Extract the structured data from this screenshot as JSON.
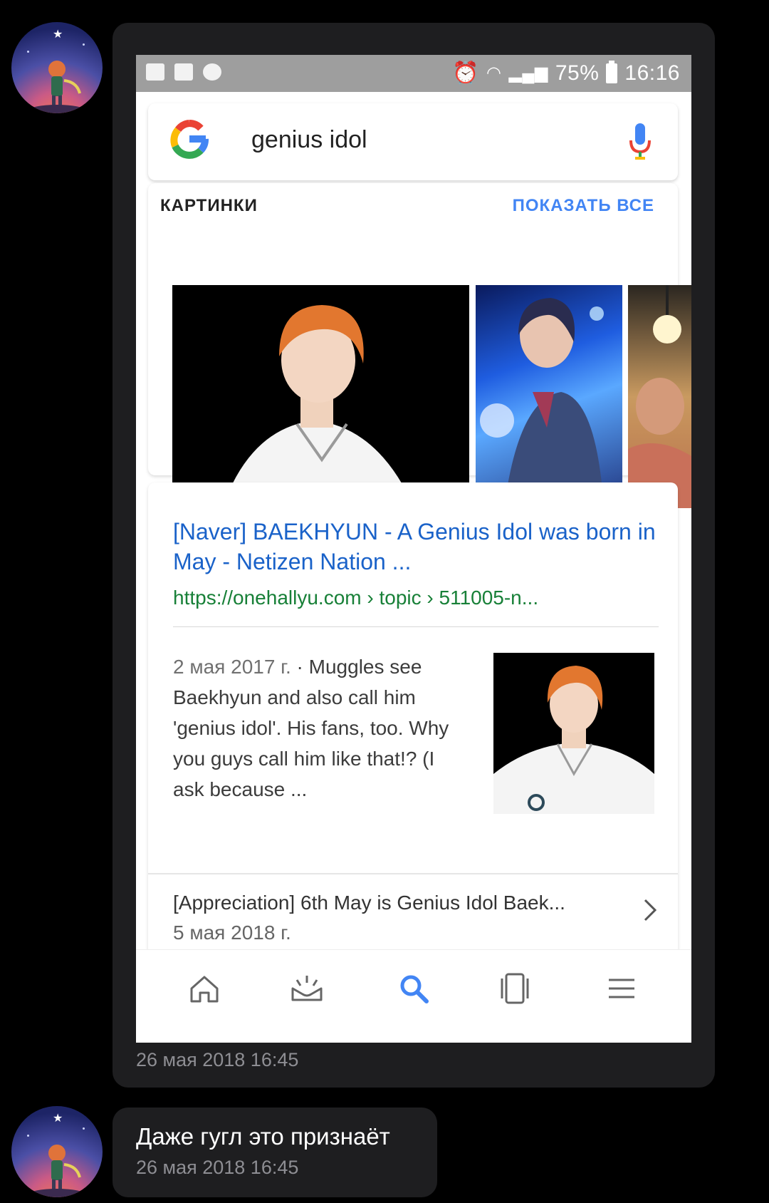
{
  "messages": [
    {
      "screenshot": {
        "status_bar": {
          "battery": "75%",
          "time": "16:16"
        },
        "search": {
          "query": "genius idol"
        },
        "images_section": {
          "heading": "КАРТИНКИ",
          "show_all": "ПОКАЗАТЬ ВСЕ"
        },
        "result1": {
          "title": "[Naver] BAEKHYUN - A Genius Idol was born in May - Netizen Nation ...",
          "url": "https://onehallyu.com › topic › 511005-n...",
          "date": "2 мая 2017 г.",
          "snippet": " · Muggles see Baekhyun and also call him 'genius idol'. His fans, too. Why you guys call him like that!? (I ask because ..."
        },
        "result2": {
          "title": "[Appreciation] 6th May is Genius Idol Baek...",
          "date": "5 мая 2018 г."
        },
        "nav_icons": [
          "home-icon",
          "updates-icon",
          "search-icon",
          "tabs-icon",
          "menu-icon"
        ]
      },
      "timestamp": "26 мая 2018 16:45"
    },
    {
      "text": "Даже гугл это признаёт",
      "timestamp": "26 мая 2018 16:45"
    }
  ],
  "colors": {
    "background": "#000000",
    "bubble": "#1e1e20",
    "link_blue": "#1a62c9",
    "url_green": "#188038",
    "google_blue": "#4285f4"
  }
}
